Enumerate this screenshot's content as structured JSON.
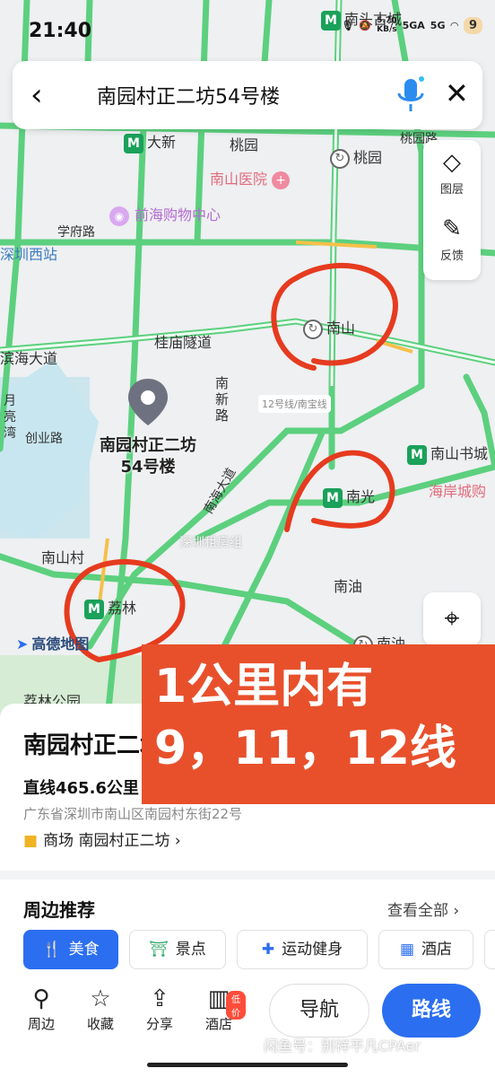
{
  "status_bar": {
    "time": "21:40",
    "speed": "5.70",
    "speed_unit": "KB/s",
    "net1": "5GA",
    "net2": "5G",
    "badge": "9"
  },
  "search": {
    "query": "南园村正二坊54号楼"
  },
  "side_panel": {
    "layers_label": "图层",
    "feedback_label": "反馈"
  },
  "map": {
    "labels": {
      "nantou": "南头古城",
      "dading": "大新",
      "taoyuan1": "桃园",
      "taoyuan_road": "桃园路",
      "taoyuan_station": "桃园",
      "hospital": "南山医院",
      "mall": "前海购物中心",
      "xuefu": "学府路",
      "shenzhen_west": "深圳西站",
      "nanshan": "南山",
      "binhai": "滨海大道",
      "guimiao": "桂庙隧道",
      "nanxin": "南新路",
      "line12": "12号线/南宝线",
      "chuangye": "创业路",
      "yueliang": "月亮湾",
      "nanshan_book": "南山书城",
      "haian": "海岸城购",
      "nanguang": "南光",
      "nanshancun": "南山村",
      "nanhai": "南海大道",
      "nanyou": "南油",
      "lilin": "荔林",
      "nanyou_station": "南油",
      "lilin_park": "荔林公园",
      "pin_name": "南园村正二坊54号楼"
    },
    "brand": "高德地图",
    "overlay_text": "深圳租房组"
  },
  "annotation": {
    "line1": "1公里内有",
    "line2": "9，11，12线"
  },
  "place": {
    "title": "南园村正二坊54号楼",
    "distance": "直线465.6公里",
    "address": "广东省深圳市南山区南园村东街22号",
    "category": "商场 南园村正二坊"
  },
  "nearby": {
    "title": "周边推荐",
    "view_all": "查看全部",
    "chips": [
      "美食",
      "景点",
      "运动健身",
      "酒店"
    ]
  },
  "bottom_bar": {
    "nearby": "周边",
    "favorite": "收藏",
    "share": "分享",
    "hotel": "酒店",
    "hotel_badge": "低价",
    "navigate": "导航",
    "route": "路线"
  },
  "watermark": "闲鱼号：别祥平凡CPAer",
  "colors": {
    "accent": "#2b6ef0",
    "metro": "#1aa15a",
    "annotation": "#e8502c",
    "circle": "#e63b1f",
    "road": "#5cd07e"
  }
}
